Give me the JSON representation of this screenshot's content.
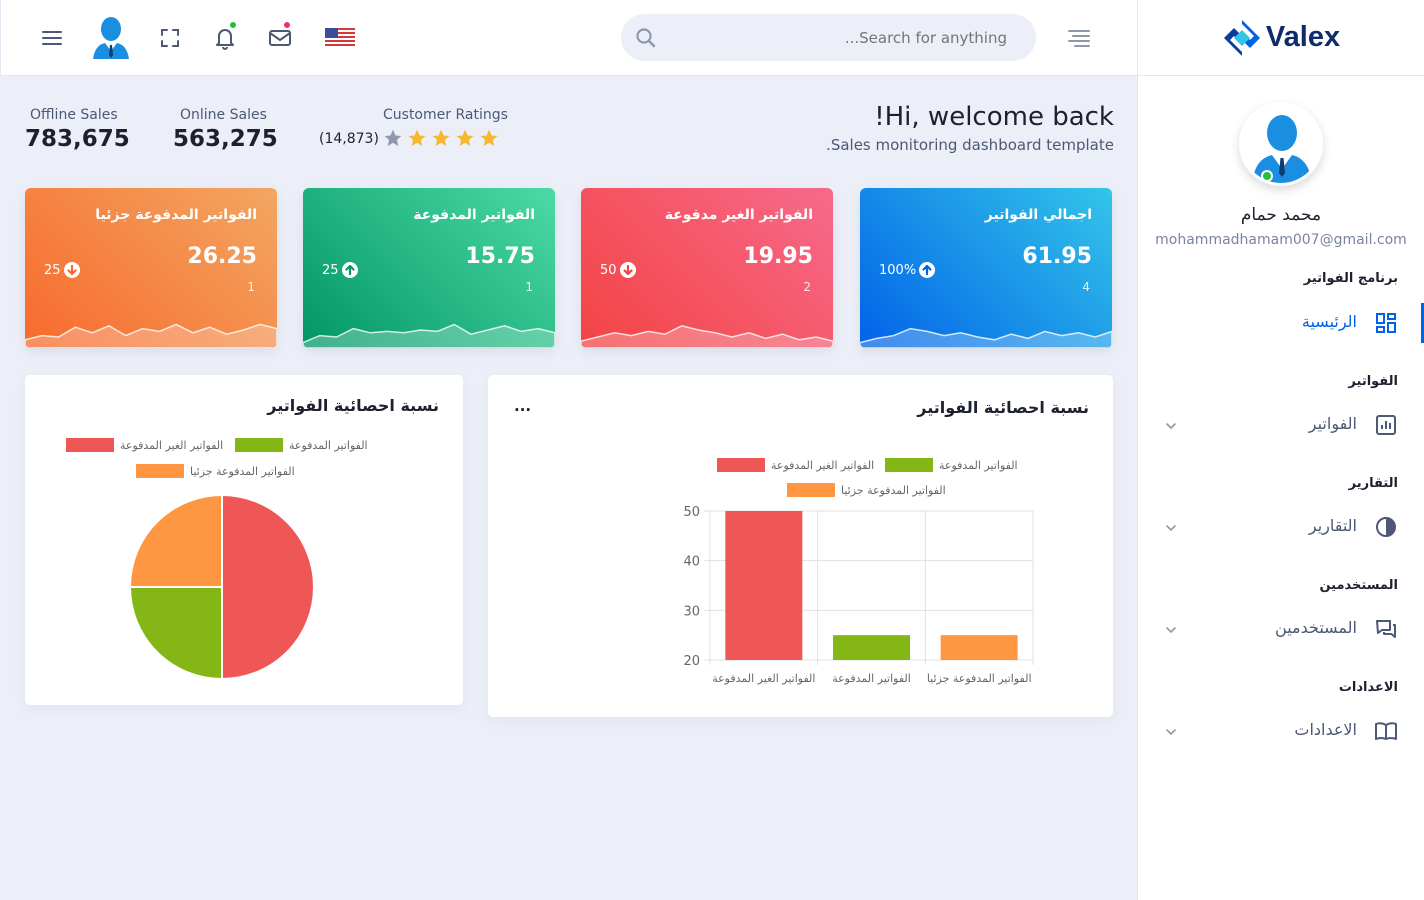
{
  "brand": {
    "name": "Valex"
  },
  "header": {
    "search_placeholder": "Search for anything...",
    "icons": [
      "menu-icon",
      "avatar",
      "fullscreen-icon",
      "bell-icon",
      "mail-icon",
      "us-flag-icon",
      "align-right-icon"
    ],
    "colors": {
      "notification_dot": "#22c03c",
      "mail_dot": "#ee335e"
    }
  },
  "stats": {
    "offline": {
      "label": "Offline Sales",
      "value": "783,675"
    },
    "online": {
      "label": "Online Sales",
      "value": "563,275"
    },
    "ratings": {
      "label": "Customer Ratings",
      "count": "(14,873)",
      "stars_filled": 4,
      "stars_total": 5
    }
  },
  "welcome": {
    "title": "Hi, welcome back!",
    "subtitle": "Sales monitoring dashboard template."
  },
  "cards": [
    {
      "title": "اجمالي الفواتير",
      "value": "61.95",
      "count": "4",
      "percent": "100%",
      "direction": "up",
      "color_from": "#0162e8",
      "color_to": "#33c5e9"
    },
    {
      "title": "الفواتير الغير مدفوعة",
      "value": "19.95",
      "count": "2",
      "percent": "50",
      "direction": "down",
      "color_from": "#f34343",
      "color_to": "#f76a8b"
    },
    {
      "title": "الفواتير المدفوعة",
      "value": "15.75",
      "count": "1",
      "percent": "25",
      "direction": "up",
      "color_from": "#029666",
      "color_to": "#4cdaa5"
    },
    {
      "title": "الفواتير المدفوعة جزئيا",
      "value": "26.25",
      "count": "1",
      "percent": "25",
      "direction": "down",
      "color_from": "#f76a2d",
      "color_to": "#f3a662"
    }
  ],
  "bar_panel": {
    "title": "نسبة احصائية الفواتير",
    "more": "..."
  },
  "pie_panel": {
    "title": "نسبة احصائية الفواتير"
  },
  "chart_data": [
    {
      "type": "bar",
      "categories": [
        "الفواتير الغير المدفوعة",
        "الفواتير المدفوعة",
        "الفواتير المدفوعة جزئيا"
      ],
      "series": [
        {
          "name": "الفواتير الغير المدفوعة",
          "color": "#ef5757",
          "values": [
            50,
            null,
            null
          ]
        },
        {
          "name": "الفواتير المدفوعة",
          "color": "#84b716",
          "values": [
            null,
            25,
            null
          ]
        },
        {
          "name": "الفواتير المدفوعة جزئيا",
          "color": "#ff9642",
          "values": [
            null,
            null,
            25
          ]
        }
      ],
      "yticks": [
        20,
        30,
        40,
        50
      ],
      "ylim": [
        20,
        50
      ],
      "grid": true,
      "legend": "top"
    },
    {
      "type": "pie",
      "labels": [
        "الفواتير الغير المدفوعة",
        "الفواتير المدفوعة",
        "الفواتير المدفوعة جزئيا"
      ],
      "values": [
        50,
        25,
        25
      ],
      "colors": [
        "#ef5757",
        "#84b716",
        "#ff9642"
      ],
      "legend": "top"
    }
  ],
  "user": {
    "name": "محمد حمام",
    "email": "mohammadhamam007@gmail.com"
  },
  "sidebar": {
    "sections": [
      {
        "heading": "برنامج الفواتير",
        "item": "الرئيسية",
        "icon": "dashboard-icon",
        "active": true
      },
      {
        "heading": "الفواتير",
        "item": "الفواتير",
        "icon": "invoice-chart-icon",
        "active": false
      },
      {
        "heading": "التقارير",
        "item": "التقارير",
        "icon": "half-circle-icon",
        "active": false
      },
      {
        "heading": "المستخدمين",
        "item": "المستخدمين",
        "icon": "chat-icon",
        "active": false
      },
      {
        "heading": "الاعدادات",
        "item": "الاعدادات",
        "icon": "book-icon",
        "active": false
      }
    ]
  }
}
